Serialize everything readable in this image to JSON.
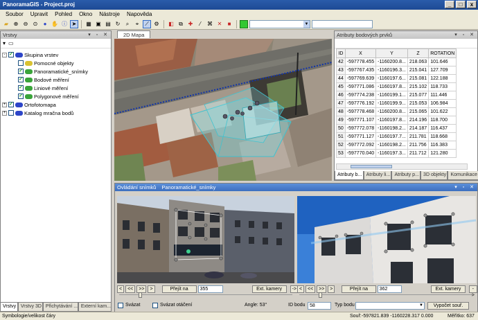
{
  "window": {
    "title": "PanoramaGIS - Project.proj",
    "buttons": [
      "_",
      "□",
      "x"
    ]
  },
  "menu": [
    "Soubor",
    "Upravit",
    "Pohled",
    "Okno",
    "Nástroje",
    "Napověda"
  ],
  "toolbar": {
    "combo_value": "",
    "color_swatch": "#32c832"
  },
  "layers_panel": {
    "title": "Vrstvy",
    "tree": [
      {
        "label": "Skupina vrstev",
        "level": 0,
        "expander": "-",
        "checked": true,
        "icon": "group-icon",
        "color": "#2d45c8"
      },
      {
        "label": "Pomocné objekty",
        "level": 1,
        "checked": false,
        "icon": "layer-icon",
        "color": "#d9c232"
      },
      {
        "label": "Panoramatické_snímky",
        "level": 1,
        "checked": true,
        "icon": "layer-icon",
        "color": "#3aa43a"
      },
      {
        "label": "Bodové měření",
        "level": 1,
        "checked": true,
        "icon": "layer-icon",
        "color": "#3aa43a"
      },
      {
        "label": "Liniové měření",
        "level": 1,
        "checked": true,
        "icon": "layer-icon",
        "color": "#3aa43a"
      },
      {
        "label": "Polygonové měření",
        "level": 1,
        "checked": true,
        "icon": "layer-icon",
        "color": "#3aa43a"
      },
      {
        "label": "Ortofotomapa",
        "level": 0,
        "expander": "+",
        "checked": true,
        "icon": "raster-icon",
        "color": "#2d45c8"
      },
      {
        "label": "Katalog mračna bodů",
        "level": 0,
        "expander": "+",
        "checked": false,
        "icon": "cloud-icon",
        "color": "#2d45c8"
      }
    ],
    "tabs": [
      "Vrstvy",
      "Vrstvy 3D",
      "Přichytávání ...",
      "Externí kam..."
    ]
  },
  "map_panel": {
    "tab": "2D Mapa"
  },
  "attributes_panel": {
    "title": "Atributy bodových prvků",
    "columns": [
      "ID",
      "X",
      "Y",
      "Z",
      "ROTATION"
    ],
    "rows": [
      [
        "42",
        "-597778.455",
        "-1160200.8...",
        "218.063",
        "101.646"
      ],
      [
        "43",
        "-597767.435",
        "-1160196.3...",
        "215.041",
        "127.709"
      ],
      [
        "44",
        "-597769.639",
        "-1160197.6...",
        "215.081",
        "122.188"
      ],
      [
        "45",
        "-597771.086",
        "-1160197.8...",
        "215.102",
        "118.733"
      ],
      [
        "46",
        "-597774.238",
        "-1160199.1...",
        "215.077",
        "111.446"
      ],
      [
        "47",
        "-597776.192",
        "-1160199.9...",
        "215.053",
        "106.984"
      ],
      [
        "48",
        "-597778.468",
        "-1160200.8...",
        "215.065",
        "101.622"
      ],
      [
        "49",
        "-597771.107",
        "-1160197.8...",
        "214.196",
        "118.700"
      ],
      [
        "50",
        "-597772.078",
        "-1160198.2...",
        "214.187",
        "116.437"
      ],
      [
        "51",
        "-597771.127",
        "-1160197.7...",
        "211.781",
        "118.668"
      ],
      [
        "52",
        "-597772.092",
        "-1160198.2...",
        "211.756",
        "116.383"
      ],
      [
        "53",
        "-597770.040",
        "-1160197.3...",
        "211.712",
        "121.280"
      ]
    ],
    "tabs": [
      "Atributy b...",
      "Atributy li...",
      "Atributy p...",
      "3D objekty",
      "Komunikace"
    ]
  },
  "photo_panel": {
    "title": "Ovládání snímků",
    "subtitle": "Panoramatické_snímky",
    "left": {
      "prev": "<",
      "first": "<<",
      "next_fast": ">>",
      "last": ">",
      "goto": "Přejít na",
      "value": "355",
      "ext": "Ext. kamery",
      "arrow": "->"
    },
    "right": {
      "prev": "<",
      "first": "<<",
      "next_fast": ">>",
      "last": ">",
      "goto": "Přejít na",
      "value": "362",
      "ext": "Ext. kamery",
      "arrow": "->"
    },
    "sync_label": "Svázat",
    "sync_rotation_label": "Svázat otáčení",
    "angle": "Angle: 53°",
    "point_id_label": "ID bodu",
    "point_id_value": "58",
    "point_type_label": "Typ bodu",
    "point_type_value": "",
    "compute_button": "Vypočet souř."
  },
  "status": {
    "left": "Symbologie/velikost čáry",
    "coords_label": "Souř:",
    "coords": "-597821.839  -1160228.317  0.000",
    "scale": "Měřítko: 637"
  }
}
